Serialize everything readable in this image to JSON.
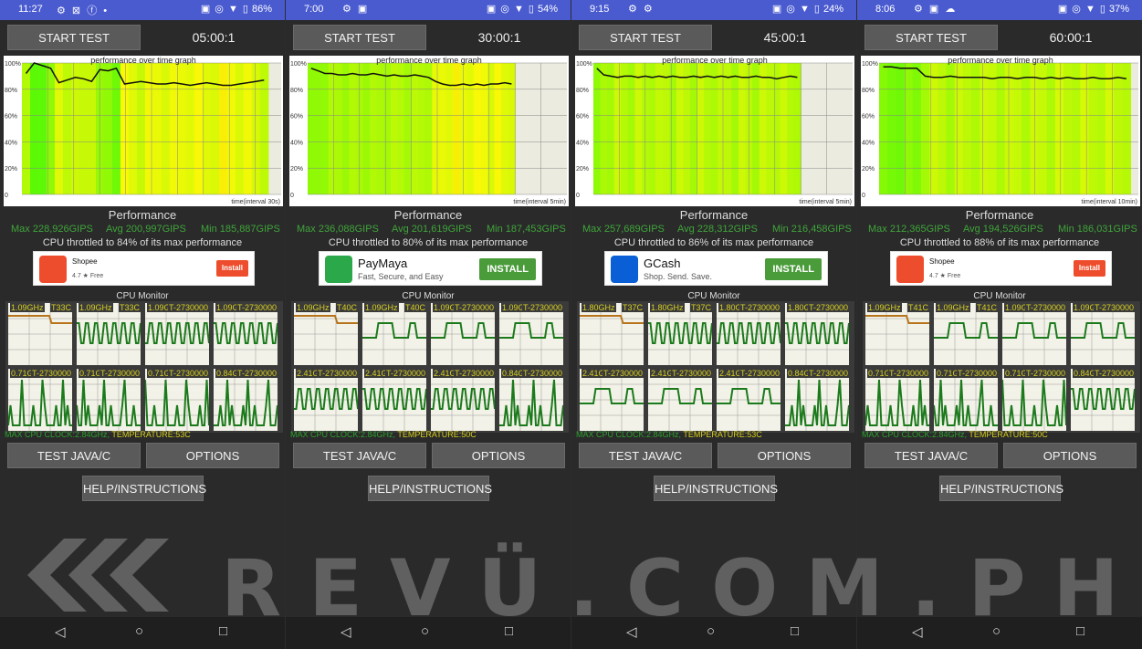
{
  "screens": [
    {
      "status": {
        "time": "11:27",
        "left_icons": "⚙ ⊠ ⓕ •",
        "right_icons": "▣ ◎ ▼ ▯",
        "battery": "86%"
      },
      "start_label": "START TEST",
      "ratio": "05:00:1",
      "graph": {
        "title": "performance over time graph",
        "interval": "time(interval 30s)",
        "end_fraction": 0.95,
        "y_ticks": [
          "100%",
          "80%",
          "60%",
          "40%",
          "20%",
          "0"
        ],
        "values": [
          92,
          100,
          98,
          96,
          85,
          87,
          89,
          88,
          86,
          95,
          94,
          96,
          84,
          85,
          86,
          85,
          84,
          84,
          85,
          84,
          83,
          84,
          85,
          84,
          83,
          83,
          84,
          85,
          86,
          87
        ]
      },
      "perf_title": "Performance",
      "max": "Max 228,926GIPS",
      "avg": "Avg 200,997GIPS",
      "min": "Min 185,887GIPS",
      "throttle": "CPU throttled to 84% of its max performance",
      "ad": {
        "name": "Shopee",
        "tagline": "4.7 ★ Free",
        "button": "Install",
        "color": "#ee4d2d",
        "button_color": "#ee4d2d",
        "small": true
      },
      "cpu_title": "CPU Monitor",
      "cores": [
        {
          "freq": "1.09GHz",
          "temp": "T33C",
          "pattern": "throttle"
        },
        {
          "freq": "1.09GHz",
          "temp": "T33C",
          "pattern": "wave"
        },
        {
          "freq": "1.09GHz",
          "temp": "T-2730000",
          "pattern": "wave"
        },
        {
          "freq": "1.09GHz",
          "temp": "T-2730000",
          "pattern": "wave"
        },
        {
          "freq": "0.71GHz",
          "temp": "T-2730000",
          "pattern": "spike"
        },
        {
          "freq": "0.71GHz",
          "temp": "T-2730000",
          "pattern": "spike"
        },
        {
          "freq": "0.71GHz",
          "temp": "T-2730000",
          "pattern": "spike"
        },
        {
          "freq": "0.84GHz",
          "temp": "T-2730000",
          "pattern": "spike"
        }
      ],
      "max_clock": "MAX CPU CLOCK:2.84GHz,",
      "temperature": "TEMPERATURE:53C",
      "java_label": "TEST JAVA/C",
      "options_label": "OPTIONS",
      "help_label": "HELP/INSTRUCTIONS"
    },
    {
      "status": {
        "time": "7:00",
        "left_icons": "⚙ ▣",
        "right_icons": "▣ ◎ ▼ ▯",
        "battery": "54%"
      },
      "start_label": "START TEST",
      "ratio": "30:00:1",
      "graph": {
        "title": "performance over time graph",
        "interval": "time(interval 5min)",
        "end_fraction": 0.8,
        "y_ticks": [
          "100%",
          "80%",
          "60%",
          "40%",
          "20%",
          "0"
        ],
        "values": [
          96,
          94,
          92,
          92,
          91,
          91,
          92,
          91,
          91,
          92,
          91,
          90,
          91,
          90,
          90,
          91,
          90,
          89,
          86,
          84,
          83,
          83,
          84,
          83,
          84,
          83,
          84,
          84,
          85,
          84
        ]
      },
      "perf_title": "Performance",
      "max": "Max 236,088GIPS",
      "avg": "Avg 201,619GIPS",
      "min": "Min 187,453GIPS",
      "throttle": "CPU throttled to 80% of its max performance",
      "ad": {
        "name": "PayMaya",
        "tagline": "Fast, Secure, and Easy",
        "button": "INSTALL",
        "color": "#2ba84a",
        "button_color": "#4a9b3a",
        "small": false
      },
      "cpu_title": "CPU Monitor",
      "cores": [
        {
          "freq": "1.09GHz",
          "temp": "T40C",
          "pattern": "throttle"
        },
        {
          "freq": "1.09GHz",
          "temp": "T40C",
          "pattern": "step"
        },
        {
          "freq": "1.09GHz",
          "temp": "T-2730000",
          "pattern": "step"
        },
        {
          "freq": "1.09GHz",
          "temp": "T-2730000",
          "pattern": "step"
        },
        {
          "freq": "2.41GHz",
          "temp": "T-2730000",
          "pattern": "wave"
        },
        {
          "freq": "2.41GHz",
          "temp": "T-2730000",
          "pattern": "wave"
        },
        {
          "freq": "2.41GHz",
          "temp": "T-2730000",
          "pattern": "wave"
        },
        {
          "freq": "0.84GHz",
          "temp": "T-2730000",
          "pattern": "spike"
        }
      ],
      "max_clock": "MAX CPU CLOCK:2.84GHz,",
      "temperature": "TEMPERATURE:50C",
      "java_label": "TEST JAVA/C",
      "options_label": "OPTIONS",
      "help_label": "HELP/INSTRUCTIONS"
    },
    {
      "status": {
        "time": "9:15",
        "left_icons": "⚙ ⚙",
        "right_icons": "▣ ◎ ▼ ▯",
        "battery": "24%"
      },
      "start_label": "START TEST",
      "ratio": "45:00:1",
      "graph": {
        "title": "performance over time graph",
        "interval": "time(interval 5min)",
        "end_fraction": 0.8,
        "y_ticks": [
          "100%",
          "80%",
          "60%",
          "40%",
          "20%",
          "0"
        ],
        "values": [
          96,
          91,
          90,
          89,
          90,
          90,
          89,
          90,
          89,
          90,
          89,
          90,
          89,
          89,
          90,
          89,
          90,
          89,
          90,
          89,
          90,
          89,
          89,
          90,
          89,
          89,
          88,
          89,
          90,
          89
        ]
      },
      "perf_title": "Performance",
      "max": "Max 257,689GIPS",
      "avg": "Avg 228,312GIPS",
      "min": "Min 216,458GIPS",
      "throttle": "CPU throttled to 86% of its max performance",
      "ad": {
        "name": "GCash",
        "tagline": "Shop. Send. Save.",
        "button": "INSTALL",
        "color": "#0a5fd6",
        "button_color": "#4a9b3a",
        "small": false
      },
      "cpu_title": "CPU Monitor",
      "cores": [
        {
          "freq": "1.80GHz",
          "temp": "T37C",
          "pattern": "throttle"
        },
        {
          "freq": "1.80GHz",
          "temp": "T37C",
          "pattern": "wave"
        },
        {
          "freq": "1.80GHz",
          "temp": "T-2730000",
          "pattern": "wave"
        },
        {
          "freq": "1.80GHz",
          "temp": "T-2730000",
          "pattern": "wave"
        },
        {
          "freq": "2.41GHz",
          "temp": "T-2730000",
          "pattern": "step"
        },
        {
          "freq": "2.41GHz",
          "temp": "T-2730000",
          "pattern": "step"
        },
        {
          "freq": "2.41GHz",
          "temp": "T-2730000",
          "pattern": "step"
        },
        {
          "freq": "0.84GHz",
          "temp": "T-2730000",
          "pattern": "spike"
        }
      ],
      "max_clock": "MAX CPU CLOCK:2.84GHz,",
      "temperature": "TEMPERATURE:53C",
      "java_label": "TEST JAVA/C",
      "options_label": "OPTIONS",
      "help_label": "HELP/INSTRUCTIONS"
    },
    {
      "status": {
        "time": "8:06",
        "left_icons": "⚙ ▣ ☁",
        "right_icons": "▣ ◎ ▼ ▯",
        "battery": "37%"
      },
      "start_label": "START TEST",
      "ratio": "60:00:1",
      "graph": {
        "title": "performance over time graph",
        "interval": "time(interval 10min)",
        "end_fraction": 0.97,
        "y_ticks": [
          "100%",
          "80%",
          "60%",
          "40%",
          "20%",
          "0"
        ],
        "values": [
          97,
          97,
          96,
          96,
          96,
          90,
          89,
          89,
          90,
          89,
          89,
          89,
          89,
          88,
          89,
          89,
          88,
          89,
          89,
          88,
          89,
          88,
          89,
          88,
          88,
          89,
          88,
          88,
          89,
          88
        ]
      },
      "perf_title": "Performance",
      "max": "Max 212,365GIPS",
      "avg": "Avg 194,526GIPS",
      "min": "Min 186,031GIPS",
      "throttle": "CPU throttled to 88% of its max performance",
      "ad": {
        "name": "Shopee",
        "tagline": "4.7 ★ Free",
        "button": "Install",
        "color": "#ee4d2d",
        "button_color": "#ee4d2d",
        "small": true
      },
      "cpu_title": "CPU Monitor",
      "cores": [
        {
          "freq": "1.09GHz",
          "temp": "T41C",
          "pattern": "throttle"
        },
        {
          "freq": "1.09GHz",
          "temp": "T41C",
          "pattern": "step"
        },
        {
          "freq": "1.09GHz",
          "temp": "T-2730000",
          "pattern": "step"
        },
        {
          "freq": "1.09GHz",
          "temp": "T-2730000",
          "pattern": "step"
        },
        {
          "freq": "0.71GHz",
          "temp": "T-2730000",
          "pattern": "spike"
        },
        {
          "freq": "0.71GHz",
          "temp": "T-2730000",
          "pattern": "spike"
        },
        {
          "freq": "0.71GHz",
          "temp": "T-2730000",
          "pattern": "spike"
        },
        {
          "freq": "0.84GHz",
          "temp": "T-2730000",
          "pattern": "wave"
        }
      ],
      "max_clock": "MAX CPU CLOCK:2.84GHz,",
      "temperature": "TEMPERATURE:50C",
      "java_label": "TEST JAVA/C",
      "options_label": "OPTIONS",
      "help_label": "HELP/INSTRUCTIONS"
    }
  ],
  "nav": {
    "back": "◁",
    "home": "○",
    "recents": "□"
  },
  "watermark": "REVÜ.COM.PH"
}
